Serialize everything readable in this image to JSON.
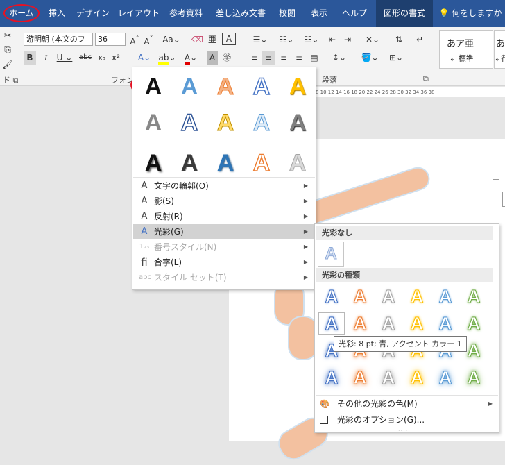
{
  "tabs": {
    "home": "ホーム",
    "insert": "挿入",
    "design": "デザイン",
    "layout": "レイアウト",
    "references": "参考資料",
    "mailings": "差し込み文書",
    "review": "校閲",
    "view": "表示",
    "help": "ヘルプ",
    "shape_format": "図形の書式",
    "tell_me": "何をしますか"
  },
  "ribbon": {
    "font_name": "游明朝 (本文のフ",
    "font_size": "36",
    "font_group_label": "フォン",
    "paragraph_group_label": "段落",
    "clipboard_group_label": "ド",
    "style_preview": "あア亜",
    "style_standard": "標準",
    "style_nospacing": "行",
    "style_next_preview": "あ"
  },
  "ruler_text": "8  10  12  14  16  18  20  22  24  26  28  30  32  34  36  38",
  "text_effects_menu": {
    "items": [
      {
        "icon": "outline-a-icon",
        "label": "文字の輪郭(O)",
        "disabled": false
      },
      {
        "icon": "shadow-a-icon",
        "label": "影(S)",
        "disabled": false
      },
      {
        "icon": "reflection-a-icon",
        "label": "反射(R)",
        "disabled": false
      },
      {
        "icon": "glow-a-icon",
        "label": "光彩(G)",
        "disabled": false,
        "highlighted": true
      },
      {
        "icon": "number-style-icon",
        "label": "番号スタイル(N)",
        "disabled": true
      },
      {
        "icon": "ligature-icon",
        "label": "合字(L)",
        "disabled": false
      },
      {
        "icon": "stylistic-set-icon",
        "label": "スタイル セット(T)",
        "disabled": true
      }
    ]
  },
  "glow_submenu": {
    "no_glow_header": "光彩なし",
    "variations_header": "光彩の種類",
    "tooltip": "光彩: 8 pt; 青, アクセント カラー 1",
    "more_colors": "その他の光彩の色(M)",
    "options": "光彩のオプション(G)...",
    "glow_colors": [
      "#4472c4",
      "#ed7d31",
      "#a5a5a5",
      "#ffc000",
      "#5b9bd5",
      "#70ad47"
    ]
  },
  "gallery_glyph": "A"
}
